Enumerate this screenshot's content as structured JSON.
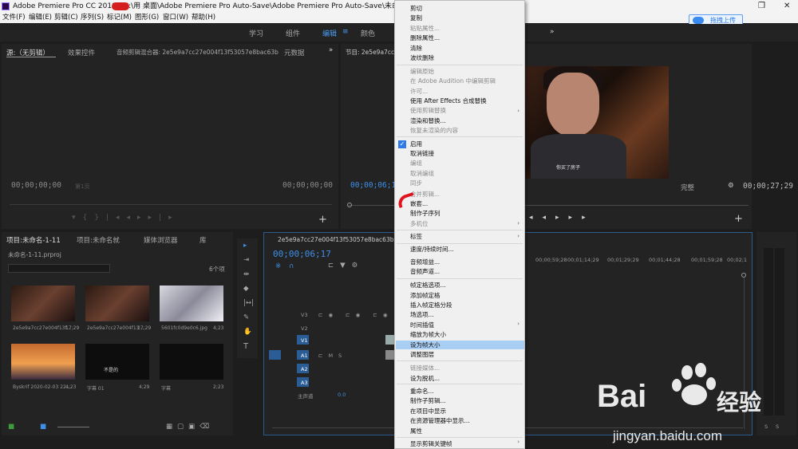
{
  "app": {
    "title": "Adobe Premiere Pro CC 2018 - C:\\用     桌面\\Adobe Premiere Pro Auto-Save\\Adobe Premiere Pro Auto-Save\\未命名-1-11.prpr"
  },
  "menubar": [
    "文件(F)",
    "编辑(E)",
    "剪辑(C)",
    "序列(S)",
    "标记(M)",
    "图形(G)",
    "窗口(W)",
    "帮助(H)"
  ],
  "upload": "拖拽上传",
  "workspaces": [
    "学习",
    "组件",
    "编辑",
    "颜色"
  ],
  "source": {
    "tabs": [
      "源:（无剪辑）",
      "效果控件",
      "音频剪辑混合器: 2e5e9a7cc27e004f13f53057e8bac63b",
      "元数据"
    ],
    "tc_left": "00;00;00;00",
    "tc_right": "00;00;00;00",
    "page": "第1页"
  },
  "program": {
    "tab": "节目: 2e5e9a7cc27e004f13",
    "tc_left": "00;00;06;17",
    "tc_right": "00;00;27;29",
    "quality": "完整",
    "subtitle": "你买了房子"
  },
  "project": {
    "tabs": [
      "项目:未命名-1-11",
      "项目:未命名就",
      "媒体浏览器",
      "库"
    ],
    "file": "未命名-1-11.prproj",
    "count": "6个项",
    "items": [
      {
        "name": "2e5e9a7cc27e004f13f...",
        "dur": "17;29"
      },
      {
        "name": "2e5e9a7cc27e004f13...",
        "dur": "27;29"
      },
      {
        "name": "5601fc0d9e0c6.jpg",
        "dur": "4;23"
      },
      {
        "name": "Byskrif 2020-02-03 22...",
        "dur": "4;23"
      },
      {
        "name": "字幕 01",
        "dur": "4;29"
      },
      {
        "name": "字幕",
        "dur": "2;23"
      }
    ],
    "caption": "不是的"
  },
  "timeline": {
    "tab": "2e5e9a7cc27e004f13f53057e8bac63b",
    "tc": "00;00;06;17",
    "ruler": [
      "00;00;59;28",
      "00;01;14;29",
      "00;01;29;29",
      "00;01;44;28",
      "00;01;59;28",
      "00;02;1"
    ],
    "tracks": [
      "V3",
      "V2",
      "V1",
      "A1",
      "A2",
      "A3"
    ],
    "master": "主声道",
    "master_val": "0.0"
  },
  "context_menu": [
    {
      "l": "剪切",
      "d": false
    },
    {
      "l": "复制",
      "d": false
    },
    {
      "l": "粘贴属性...",
      "d": true
    },
    {
      "l": "删除属性...",
      "d": false
    },
    {
      "l": "清除",
      "d": false
    },
    {
      "l": "波纹删除",
      "d": false
    },
    {
      "l": "编辑原始",
      "d": true
    },
    {
      "l": "在 Adobe Audition 中编辑剪辑",
      "d": true
    },
    {
      "l": "使用 After Effects 合成替换",
      "d": false
    },
    {
      "l": "许可...",
      "d": true
    },
    {
      "l": "使用剪辑替换",
      "d": true
    },
    {
      "l": "渲染和替换...",
      "d": false
    },
    {
      "l": "恢复未渲染的内容",
      "d": true
    },
    {
      "l": "启用",
      "d": false
    },
    {
      "l": "取消链接",
      "d": false
    },
    {
      "l": "编组",
      "d": true
    },
    {
      "l": "取消编组",
      "d": true
    },
    {
      "l": "同步",
      "d": true
    },
    {
      "l": "合并剪辑...",
      "d": true
    },
    {
      "l": "嵌套...",
      "d": false
    },
    {
      "l": "制作子序列",
      "d": false
    },
    {
      "l": "多机位",
      "d": true
    },
    {
      "l": "标签",
      "d": false
    },
    {
      "l": "速度/持续时间...",
      "d": false
    },
    {
      "l": "音频增益...",
      "d": false
    },
    {
      "l": "音频声道...",
      "d": false
    },
    {
      "l": "帧定格选项...",
      "d": false
    },
    {
      "l": "添加帧定格",
      "d": false
    },
    {
      "l": "插入帧定格分段",
      "d": false
    },
    {
      "l": "场选项...",
      "d": false
    },
    {
      "l": "时间插值",
      "d": false
    },
    {
      "l": "缩放为帧大小",
      "d": false
    },
    {
      "l": "设为帧大小",
      "d": false
    },
    {
      "l": "调整图层",
      "d": false
    },
    {
      "l": "链接媒体...",
      "d": true
    },
    {
      "l": "设为脱机...",
      "d": false
    },
    {
      "l": "重命名...",
      "d": false
    },
    {
      "l": "制作子剪辑...",
      "d": false
    },
    {
      "l": "在项目中显示",
      "d": false
    },
    {
      "l": "在资源管理器中显示...",
      "d": false
    },
    {
      "l": "属性",
      "d": false
    },
    {
      "l": "显示剪辑关键帧",
      "d": false
    }
  ],
  "watermark": {
    "brand": "Bai",
    "brand2": "经验",
    "url": "jingyan.baidu.com"
  }
}
